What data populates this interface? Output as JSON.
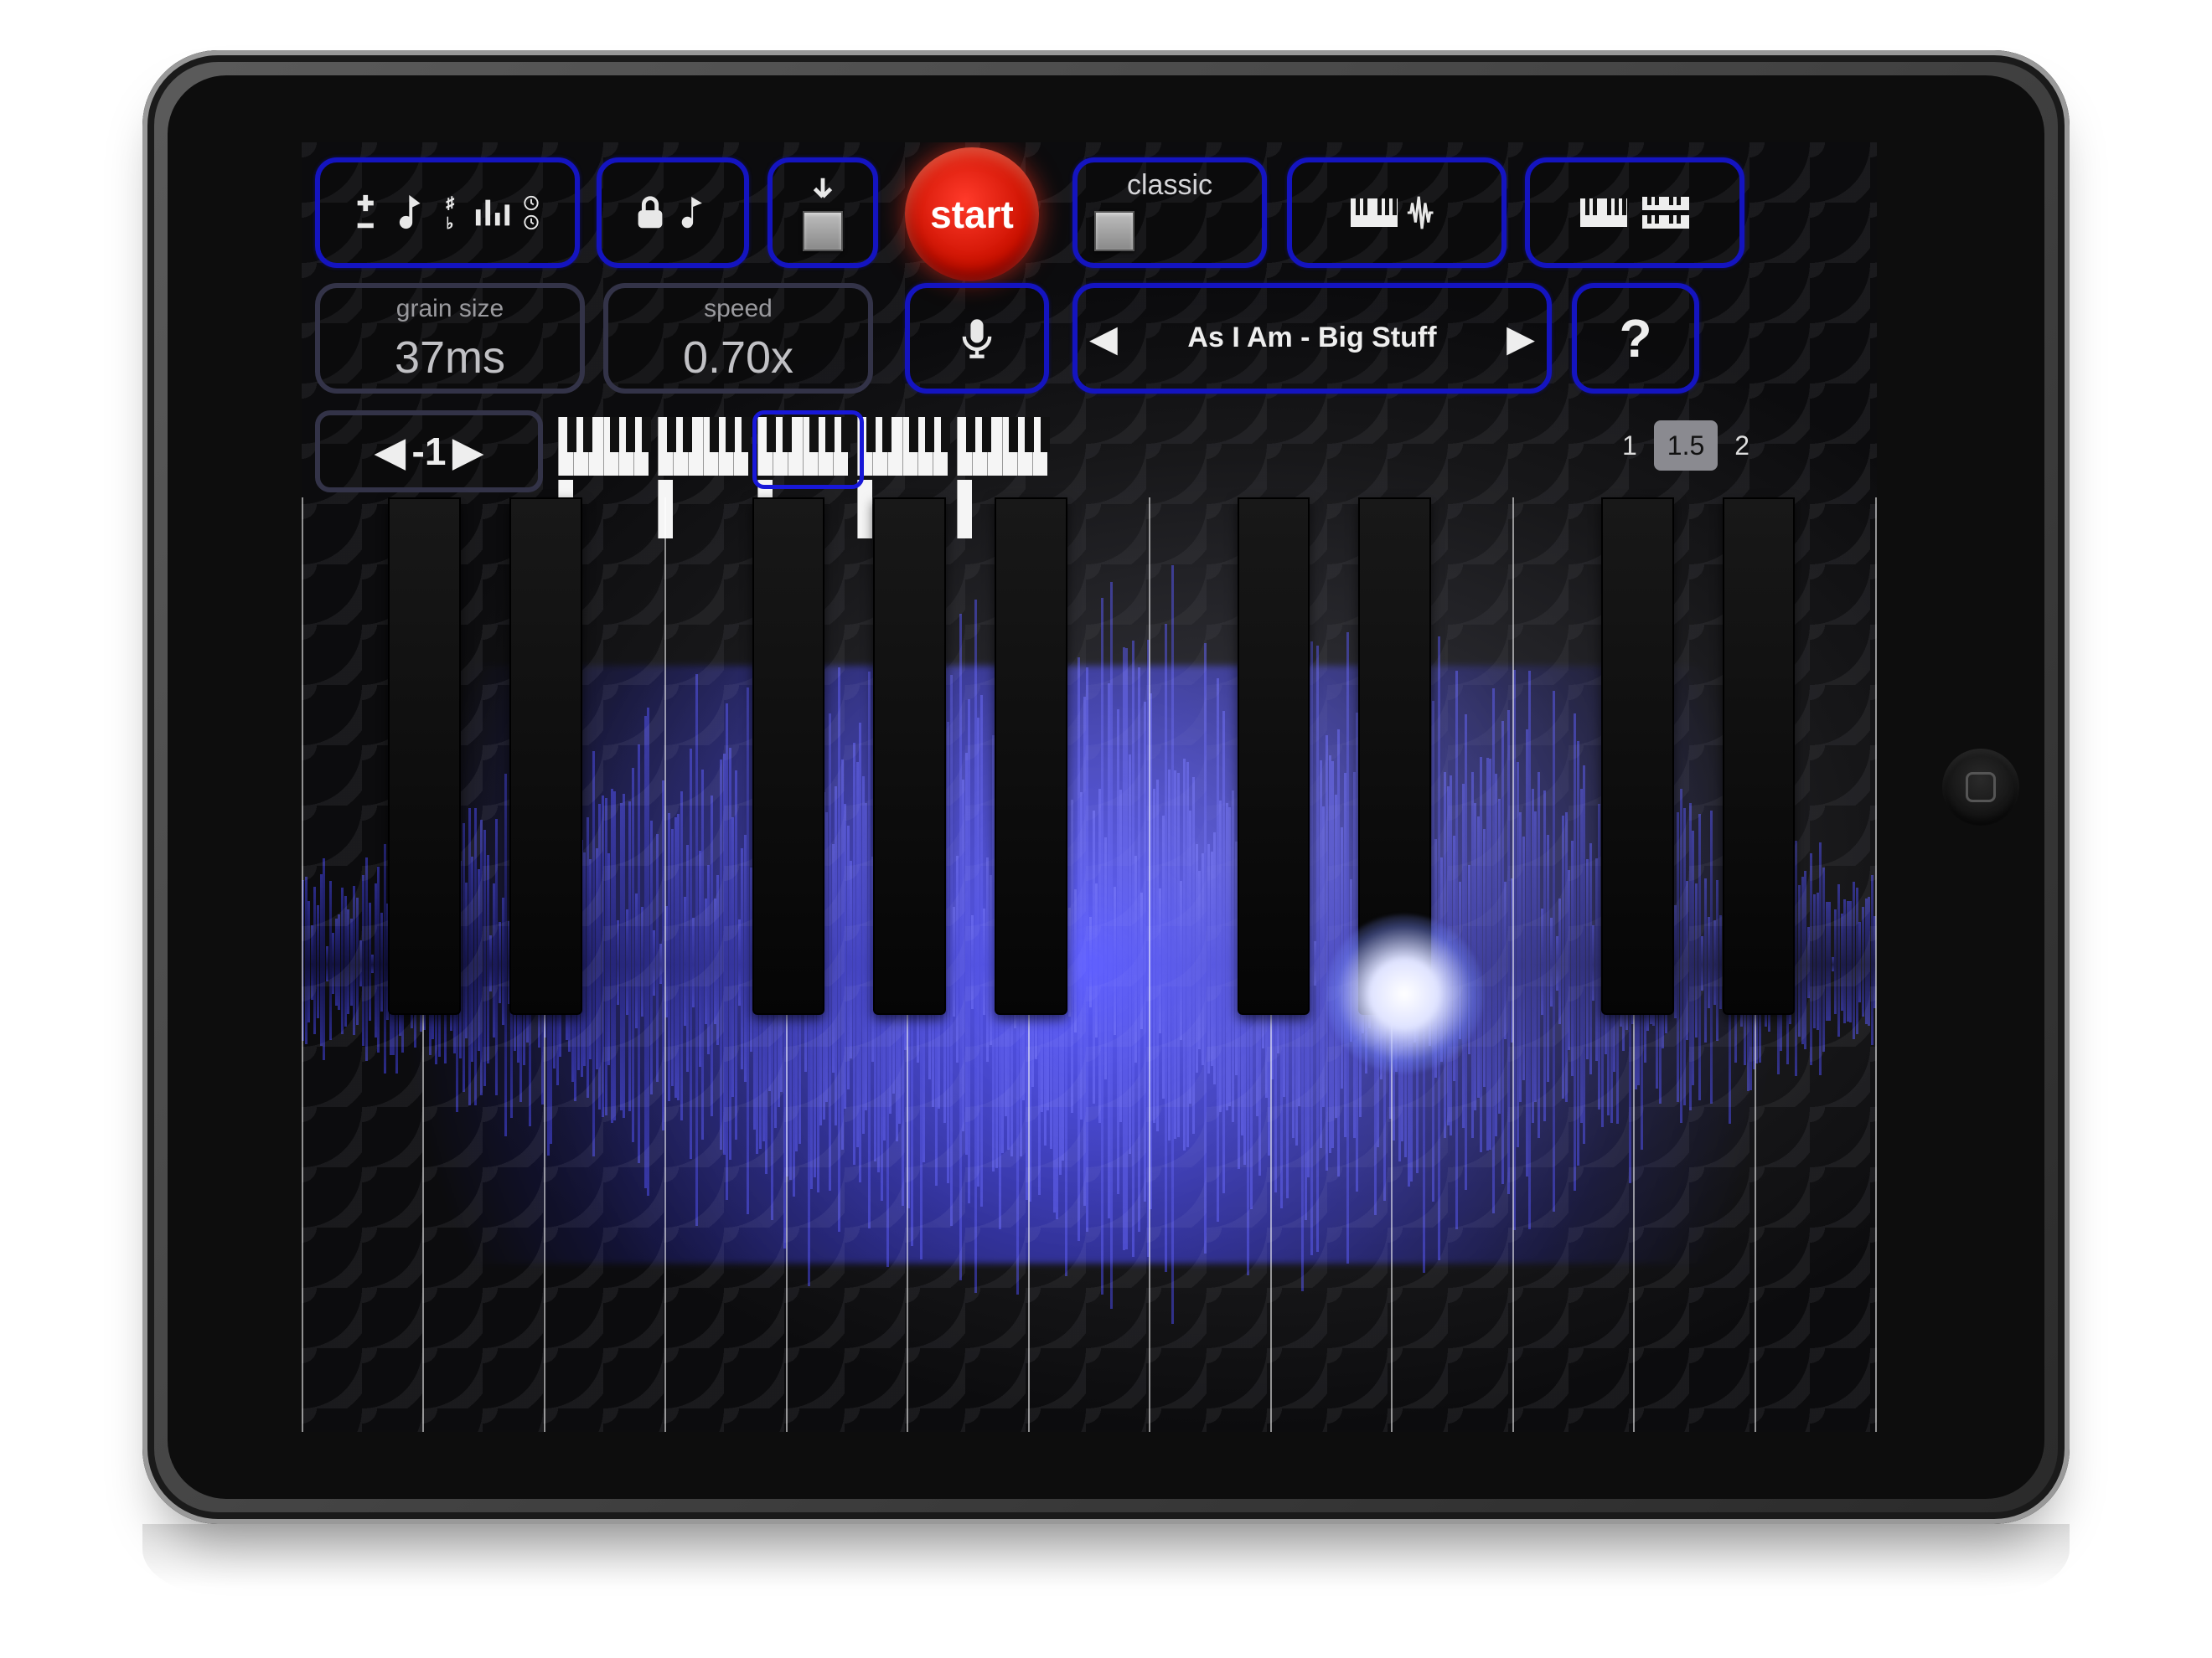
{
  "device": {
    "type": "tablet",
    "orientation": "landscape"
  },
  "toolbar_row1": {
    "settings_panel": {
      "name": "pitch-tuning-tools"
    },
    "lock_panel": {
      "name": "lock-note"
    },
    "down_panel": {
      "name": "drop-sample"
    },
    "start_label": "start",
    "mode_label": "classic",
    "view_keyboard_wave": {
      "name": "keyboard-waveform-toggle"
    },
    "view_dual_keyboard": {
      "name": "dual-keyboard-toggle"
    }
  },
  "toolbar_row2": {
    "grain_size_label": "grain size",
    "grain_size_value": "37ms",
    "speed_label": "speed",
    "speed_value": "0.70x",
    "mic_panel": {
      "name": "microphone-input"
    },
    "song_prev": "◀",
    "song_title": "As I Am - Big Stuff",
    "song_next": "▶",
    "help_label": "?"
  },
  "octave_row": {
    "prev": "◀",
    "value": "-1",
    "next": "▶",
    "scale_options": [
      "1",
      "1.5",
      "2"
    ],
    "scale_selected": "1.5",
    "mini_keyboard_octaves": 5,
    "selected_mini_octave_index": 2
  },
  "main_keyboard": {
    "visible_white_keys": 13,
    "start_note": "C",
    "black_key_positions_pct": [
      5.5,
      13.2,
      28.6,
      36.3,
      44.0,
      59.4,
      67.1,
      82.5,
      90.2
    ],
    "black_key_width_pct": 4.4
  },
  "waveform": {
    "playhead_position_pct": 70,
    "amplitude_seed": 42
  },
  "colors": {
    "accent": "#1414c0",
    "start_button": "#e41f12",
    "text_dim": "#9a9a9e",
    "text": "#e8e8e8"
  }
}
